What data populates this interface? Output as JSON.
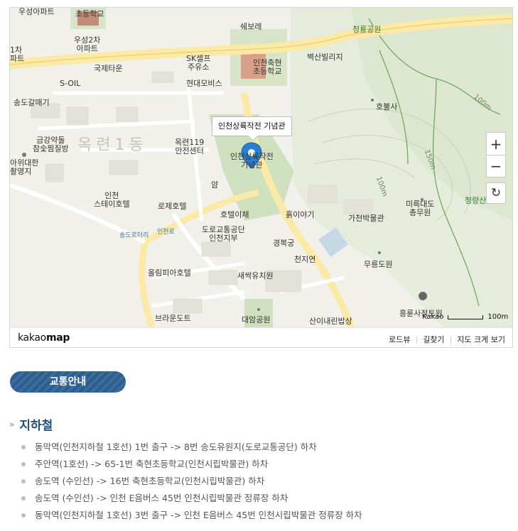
{
  "map": {
    "infobox_label": "인천상륙작전 기념관",
    "zoom_in_symbol": "+",
    "zoom_out_symbol": "−",
    "reset_symbol": "↻",
    "scale_provider": "Kakao",
    "scale_distance": "100m",
    "brand_prefix": "kakao",
    "brand_suffix": "map",
    "links": [
      "로드뷰",
      "길찾기",
      "지도 크게 보기"
    ],
    "labels": {
      "area_big": "옥련1동",
      "l1": "우성아파트",
      "l2": "초등학교",
      "l3": "우성2차\n아파트",
      "l4": "1차\n파트",
      "l5": "국제타운",
      "l6": "S-OIL",
      "l7": "송도갈매기",
      "l8": "금강약돌\n참숯찜질방",
      "l9": "아위대한\n촬영지",
      "l10": "쉐보레",
      "l11": "SK셀프\n주유소",
      "l12": "현대모비스",
      "l13": "인천축현\n초등학교",
      "l14": "벽산빌리지",
      "l15": "청룡공원",
      "l16": "호불사",
      "l17": "옥련119\n안전센터",
      "l18": "인천상륙작전\n기념관",
      "l19": "얌",
      "l20": "인천\n스테이호텔",
      "l21": "로제호텔",
      "l22": "호텔이채",
      "l23": "도로교통공단\n인천지부",
      "l24": "흙이야기",
      "l25": "가천박물관",
      "l26": "미륵대도\n총무원",
      "l27": "청량산",
      "l28": "경복궁",
      "l29": "천지연",
      "l30": "무릉도원",
      "l31": "송도로터리",
      "l32": "인천로",
      "l33": "올림피아호텔",
      "l34": "새싹유치원",
      "l35": "브라운도트",
      "l36": "대암공원",
      "l37": "산이내린밥상",
      "l38": "흥륜사정토원",
      "l39": "100m",
      "l40": "150m",
      "l41": "100m"
    }
  },
  "section": {
    "title": "교통안내"
  },
  "subway": {
    "heading": "지하철",
    "routes": [
      "동막역(인천지하철 1호선) 1번 출구 -> 8번 송도유원지(도로교통공단) 하차",
      "주안역(1호선) -> 65-1번 축현초등학교(인천시립박물관) 하차",
      "송도역 (수인선) -> 16번 축현초등학교(인천시립박물관) 하차",
      "송도역 (수인선) -> 인천 E음버스 45번 인천시립박물관 정류장 하차",
      "동막역(인천지하철 1호선) 3번 출구 -> 인천 E음버스 45번 인천시립박물관 정류장 하차"
    ]
  },
  "colors": {
    "badge": "#2c5d8c",
    "heading": "#1f4f7a",
    "marker": "#2b7fd1",
    "road": "#fbe9a6"
  }
}
